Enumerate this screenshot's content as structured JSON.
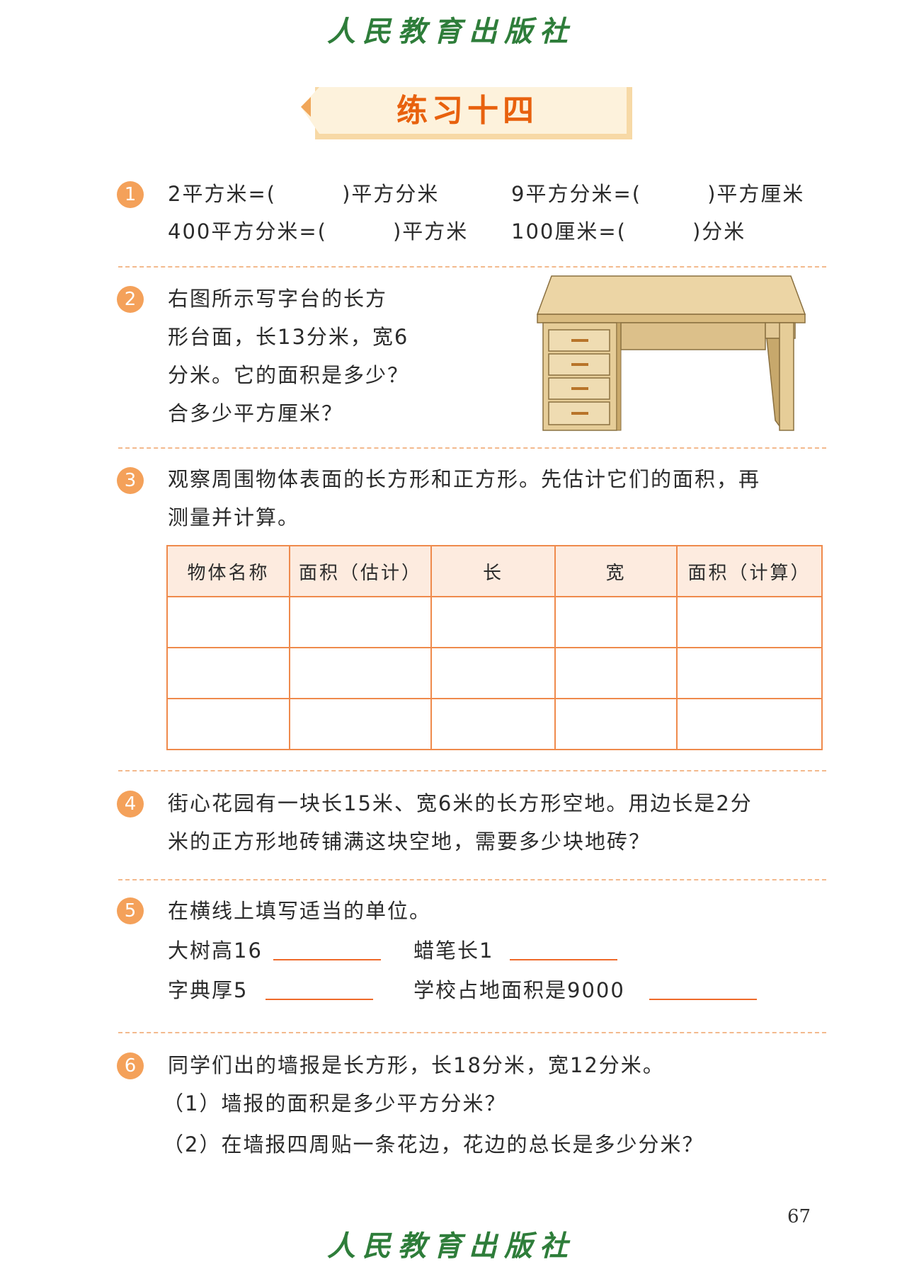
{
  "publisher": "人民教育出版社",
  "title": "练习十四",
  "page_number": "67",
  "problems": [
    {
      "number": "1",
      "lines": [
        [
          "2平方米=(　　　)平方分米",
          "9平方分米=(　　　)平方厘米"
        ],
        [
          "400平方分米=(　　　)平方米",
          "100厘米=(　　　)分米"
        ]
      ]
    },
    {
      "number": "2",
      "lines": [
        "右图所示写字台的长方",
        "形台面，长13分米，宽6",
        "分米。它的面积是多少？",
        "合多少平方厘米？"
      ]
    },
    {
      "number": "3",
      "lines": [
        "观察周围物体表面的长方形和正方形。先估计它们的面积，再",
        "测量并计算。"
      ],
      "table_headers": [
        "物体名称",
        "面积（估计）",
        "长",
        "宽",
        "面积（计算）"
      ],
      "table_rows": [
        [
          "",
          "",
          "",
          "",
          ""
        ],
        [
          "",
          "",
          "",
          "",
          ""
        ],
        [
          "",
          "",
          "",
          "",
          ""
        ]
      ]
    },
    {
      "number": "4",
      "lines": [
        "街心花园有一块长15米、宽6米的长方形空地。用边长是2分",
        "米的正方形地砖铺满这块空地，需要多少块地砖？"
      ]
    },
    {
      "number": "5",
      "lines": [
        "在横线上填写适当的单位。"
      ],
      "fills": [
        "大树高16",
        "蜡笔长1",
        "字典厚5",
        "学校占地面积是9000"
      ]
    },
    {
      "number": "6",
      "lines": [
        "同学们出的墙报是长方形，长18分米，宽12分米。",
        "（1）墙报的面积是多少平方分米？",
        "（2）在墙报四周贴一条花边，花边的总长是多少分米？"
      ]
    }
  ],
  "colors": {
    "accent": "#e8610e",
    "number_badge": "#f4a15a",
    "table_border": "#ef8a4c",
    "table_header_bg": "#fdebdf",
    "publisher_green": "#2e7d3a"
  }
}
